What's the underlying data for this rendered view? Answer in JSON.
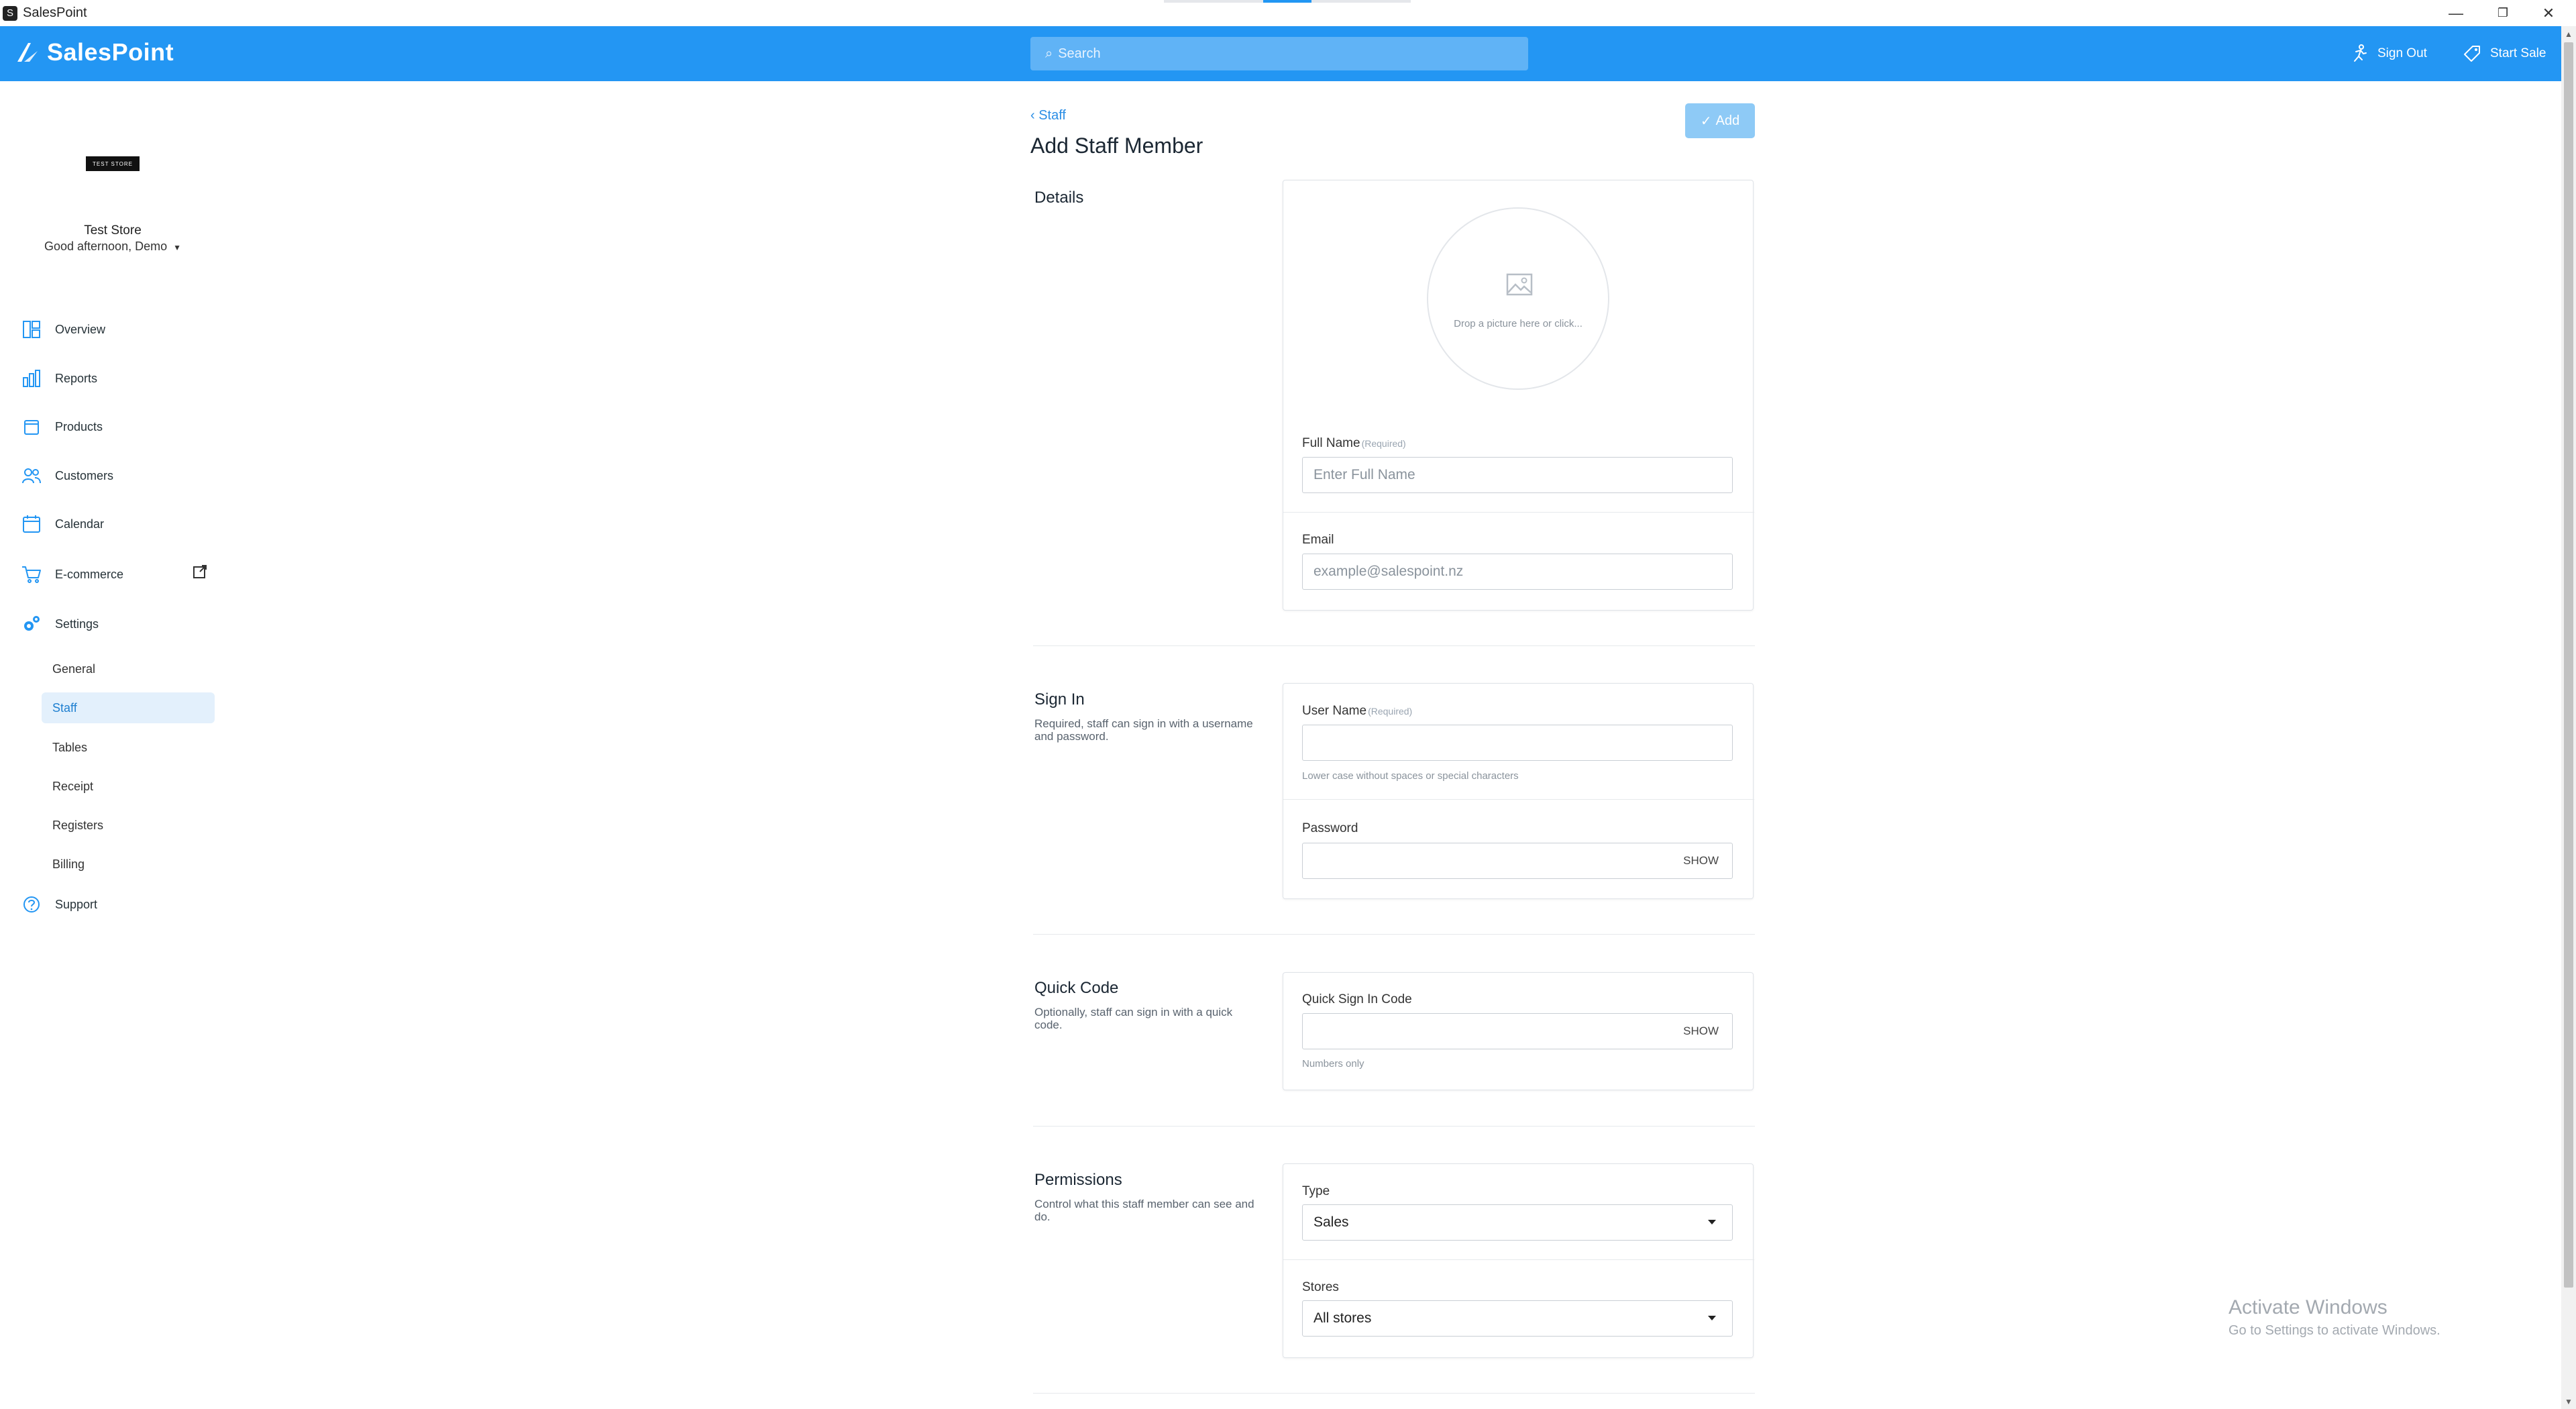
{
  "window": {
    "title": "SalesPoint",
    "minimize": "—",
    "restore": "❐",
    "close": "✕"
  },
  "header": {
    "brand": "SalesPoint",
    "search_placeholder": "Search",
    "sign_out": "Sign Out",
    "start_sale": "Start Sale"
  },
  "sidebar": {
    "store_logo_text": "TEST STORE",
    "store_name": "Test Store",
    "greeting": "Good afternoon, Demo",
    "items": [
      {
        "label": "Overview"
      },
      {
        "label": "Reports"
      },
      {
        "label": "Products"
      },
      {
        "label": "Customers"
      },
      {
        "label": "Calendar"
      },
      {
        "label": "E-commerce"
      },
      {
        "label": "Settings"
      }
    ],
    "settings_sub": [
      {
        "label": "General"
      },
      {
        "label": "Staff",
        "active": true
      },
      {
        "label": "Tables"
      },
      {
        "label": "Receipt"
      },
      {
        "label": "Registers"
      },
      {
        "label": "Billing"
      }
    ],
    "support": "Support"
  },
  "page": {
    "back_label": "Staff",
    "title": "Add Staff Member",
    "add_button": "Add"
  },
  "details": {
    "title": "Details",
    "avatar_drop_text": "Drop a picture here or click...",
    "full_name_label": "Full Name",
    "full_name_required": "(Required)",
    "full_name_placeholder": "Enter Full Name",
    "email_label": "Email",
    "email_placeholder": "example@salespoint.nz"
  },
  "sign_in": {
    "title": "Sign In",
    "description": "Required, staff can sign in with a username and password.",
    "username_label": "User Name",
    "username_required": "(Required)",
    "username_value": "",
    "username_hint": "Lower case without spaces or special characters",
    "password_label": "Password",
    "password_value": "",
    "show_label": "SHOW"
  },
  "quick_code": {
    "title": "Quick Code",
    "description": "Optionally, staff can sign in with a quick code.",
    "code_label": "Quick Sign In Code",
    "code_value": "",
    "show_label": "SHOW",
    "hint": "Numbers only"
  },
  "permissions": {
    "title": "Permissions",
    "description": "Control what this staff member can see and do.",
    "type_label": "Type",
    "type_value": "Sales",
    "stores_label": "Stores",
    "stores_value": "All stores"
  },
  "watermark": {
    "line1": "Activate Windows",
    "line2": "Go to Settings to activate Windows."
  },
  "colors": {
    "primary": "#2396f3",
    "active_bg": "#e3f0fc",
    "add_button_disabled": "#8ecaf6"
  }
}
